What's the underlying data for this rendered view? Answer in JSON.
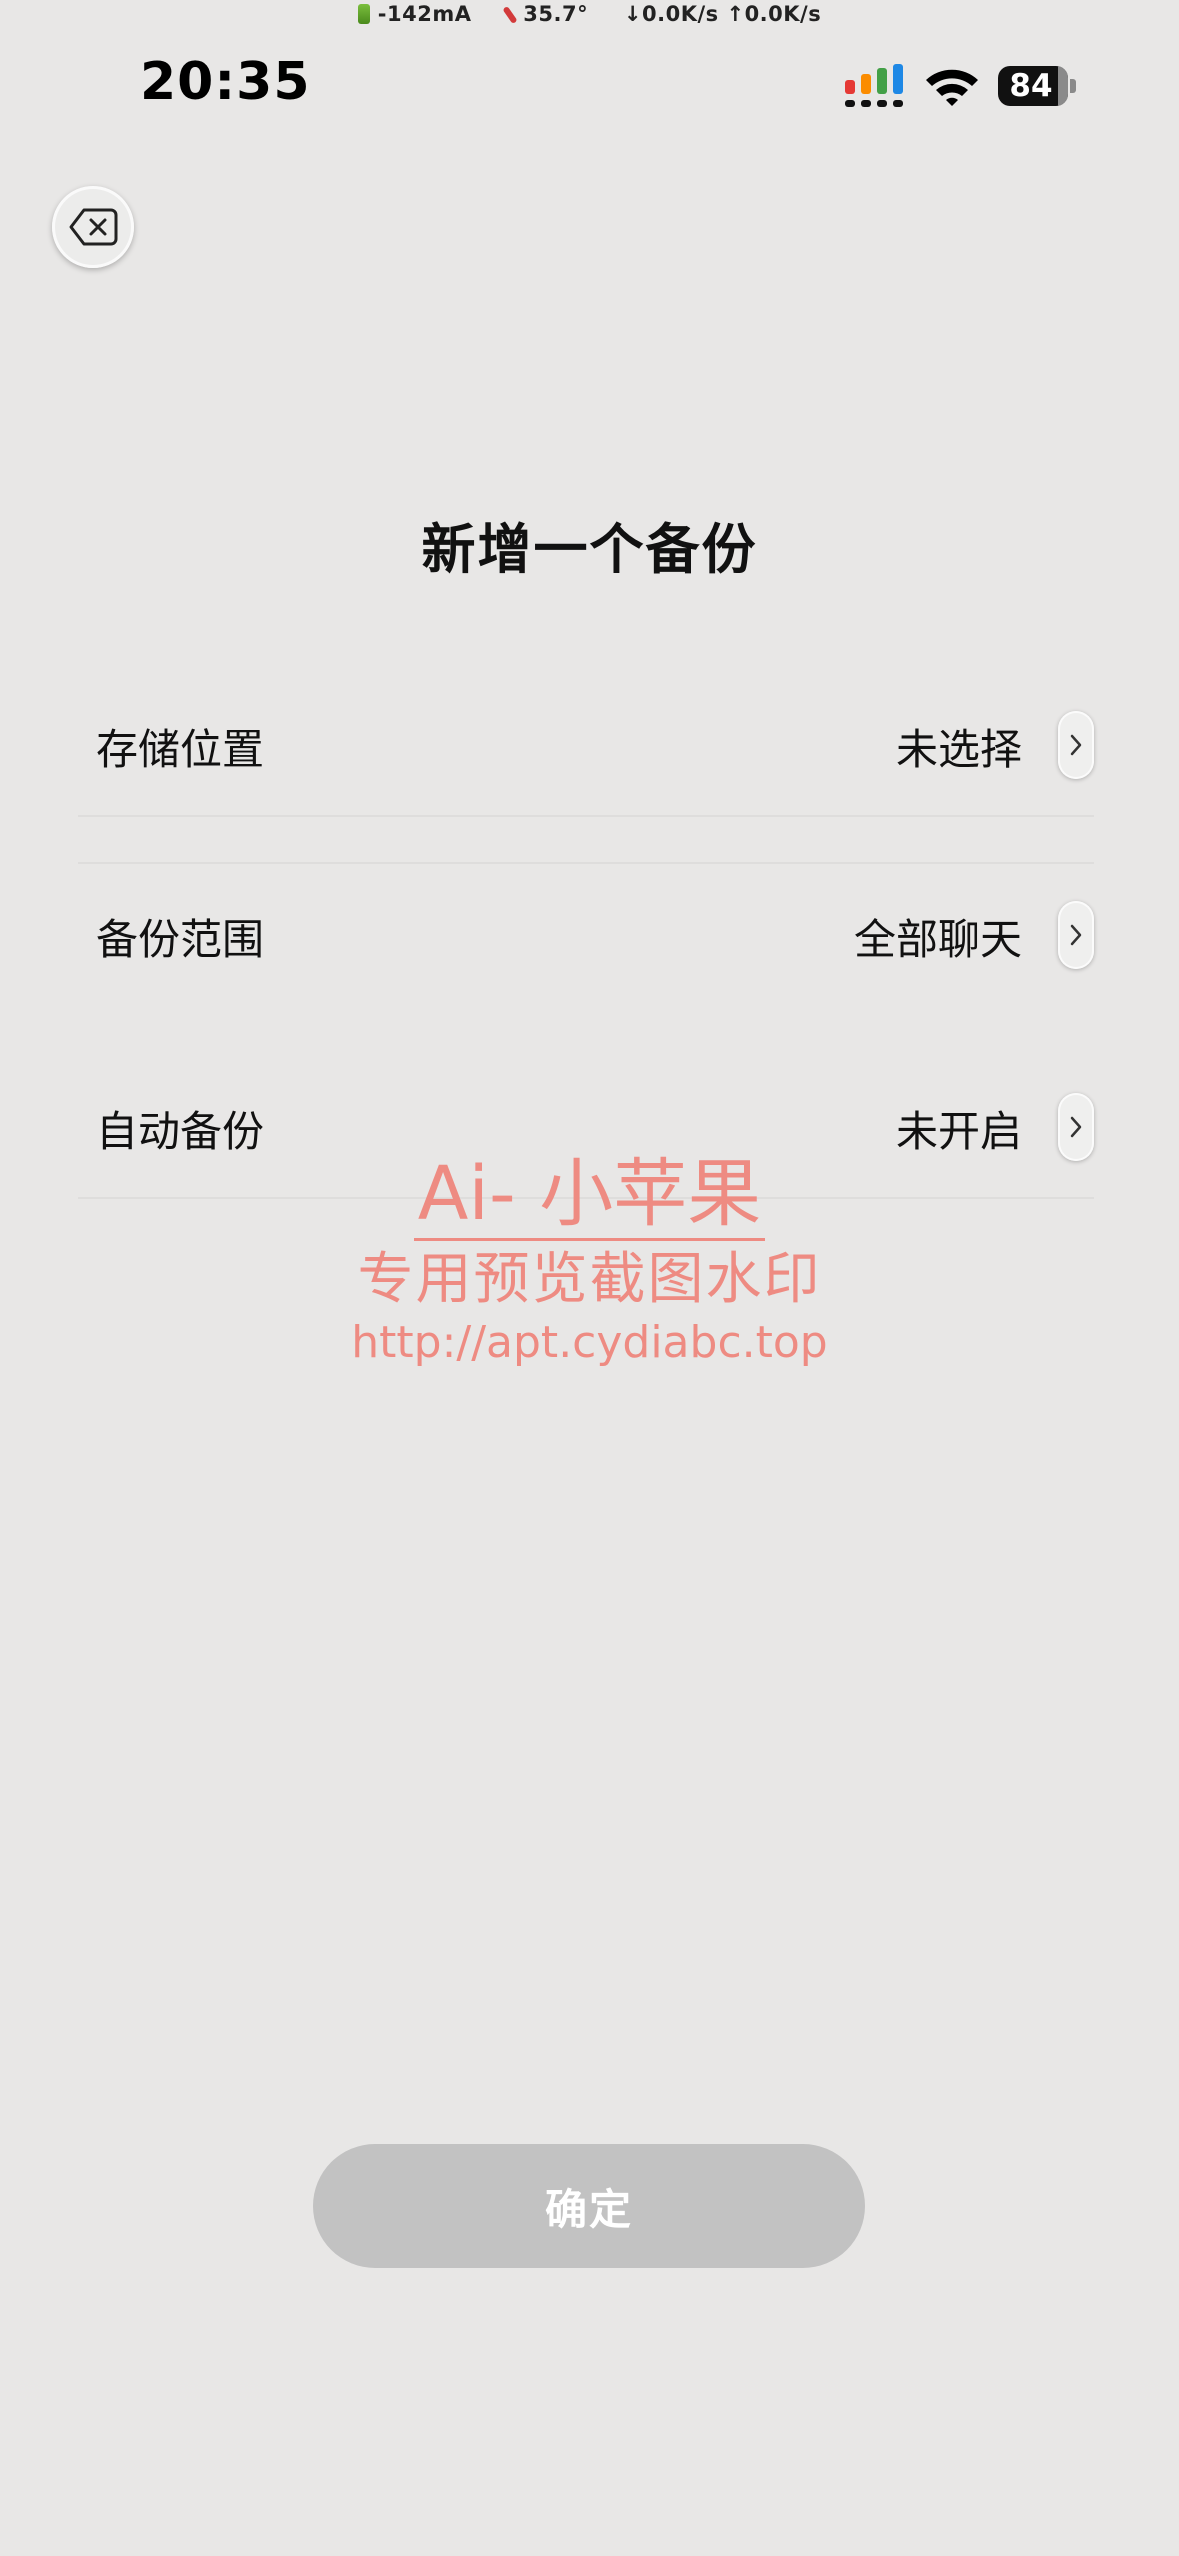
{
  "status_bar": {
    "current": "-142mA",
    "temperature": "35.7°",
    "download": "↓0.0K/s",
    "upload": "↑0.0K/s",
    "time": "20:35",
    "battery_level": "84",
    "signal_colors": [
      "#e53935",
      "#fb8c00",
      "#43a047",
      "#1e88e5"
    ]
  },
  "header": {
    "close_icon": "delete-backspace-icon",
    "title": "新增一个备份"
  },
  "settings": [
    {
      "label": "存储位置",
      "value": "未选择",
      "icon": "chevron-right-icon"
    },
    {
      "label": "备份范围",
      "value": "全部聊天",
      "icon": "chevron-right-icon"
    },
    {
      "label": "自动备份",
      "value": "未开启",
      "icon": "chevron-right-icon"
    }
  ],
  "watermark": {
    "line1": "Ai- 小苹果",
    "line2": "专用预览截图水印",
    "line3": "http://apt.cydiabc.top",
    "color": "#ee8b82"
  },
  "confirm_button": {
    "label": "确定",
    "enabled": false
  }
}
